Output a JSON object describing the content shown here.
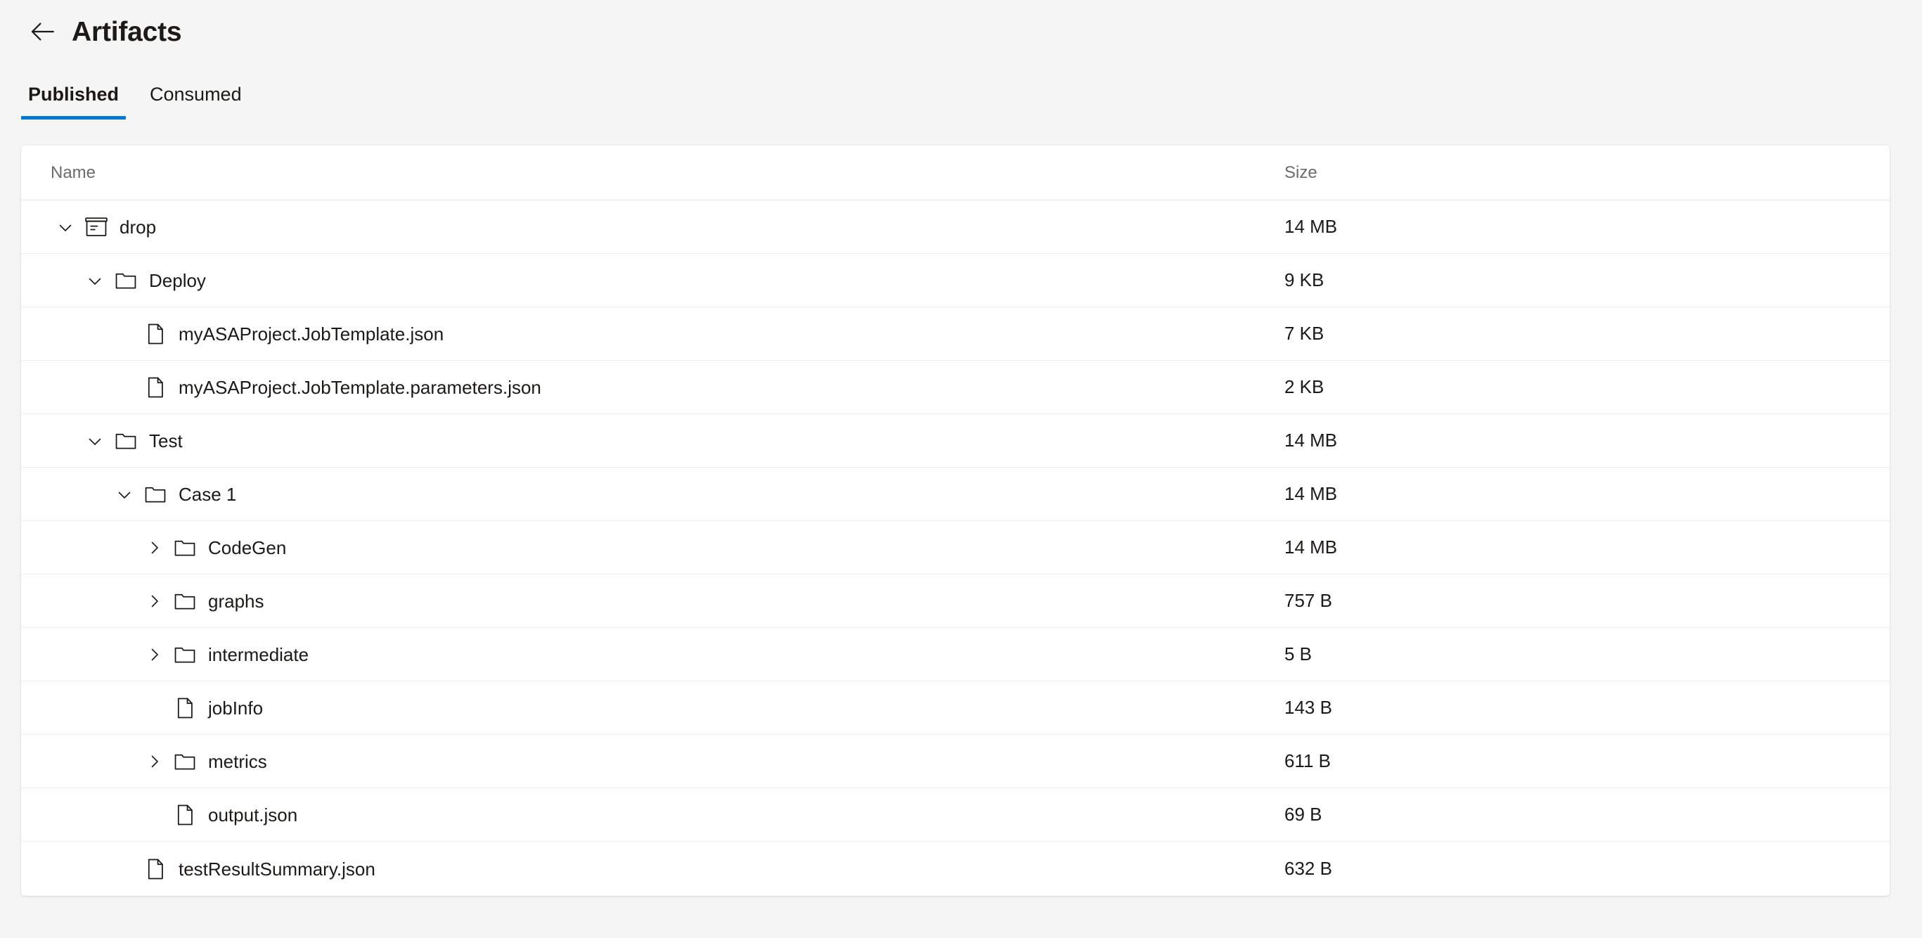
{
  "header": {
    "back_icon": "arrow-left-icon",
    "title": "Artifacts"
  },
  "tabs": [
    {
      "label": "Published",
      "active": true
    },
    {
      "label": "Consumed",
      "active": false
    }
  ],
  "table": {
    "columns": [
      {
        "key": "name",
        "label": "Name"
      },
      {
        "key": "size",
        "label": "Size"
      }
    ],
    "rows": [
      {
        "name": "drop",
        "size": "14 MB",
        "depth": 0,
        "kind": "artifact",
        "icon": "package-icon",
        "expanded": true,
        "has_children": true
      },
      {
        "name": "Deploy",
        "size": "9 KB",
        "depth": 1,
        "kind": "folder",
        "icon": "folder-icon",
        "expanded": true,
        "has_children": true
      },
      {
        "name": "myASAProject.JobTemplate.json",
        "size": "7 KB",
        "depth": 2,
        "kind": "file",
        "icon": "file-icon",
        "expanded": false,
        "has_children": false
      },
      {
        "name": "myASAProject.JobTemplate.parameters.json",
        "size": "2 KB",
        "depth": 2,
        "kind": "file",
        "icon": "file-icon",
        "expanded": false,
        "has_children": false
      },
      {
        "name": "Test",
        "size": "14 MB",
        "depth": 1,
        "kind": "folder",
        "icon": "folder-icon",
        "expanded": true,
        "has_children": true
      },
      {
        "name": "Case 1",
        "size": "14 MB",
        "depth": 2,
        "kind": "folder",
        "icon": "folder-icon",
        "expanded": true,
        "has_children": true
      },
      {
        "name": "CodeGen",
        "size": "14 MB",
        "depth": 3,
        "kind": "folder",
        "icon": "folder-icon",
        "expanded": false,
        "has_children": true
      },
      {
        "name": "graphs",
        "size": "757 B",
        "depth": 3,
        "kind": "folder",
        "icon": "folder-icon",
        "expanded": false,
        "has_children": true
      },
      {
        "name": "intermediate",
        "size": "5 B",
        "depth": 3,
        "kind": "folder",
        "icon": "folder-icon",
        "expanded": false,
        "has_children": true
      },
      {
        "name": "jobInfo",
        "size": "143 B",
        "depth": 3,
        "kind": "file",
        "icon": "file-icon",
        "expanded": false,
        "has_children": false
      },
      {
        "name": "metrics",
        "size": "611 B",
        "depth": 3,
        "kind": "folder",
        "icon": "folder-icon",
        "expanded": false,
        "has_children": true
      },
      {
        "name": "output.json",
        "size": "69 B",
        "depth": 3,
        "kind": "file",
        "icon": "file-icon",
        "expanded": false,
        "has_children": false
      },
      {
        "name": "testResultSummary.json",
        "size": "632 B",
        "depth": 2,
        "kind": "file",
        "icon": "file-icon",
        "expanded": false,
        "has_children": false
      }
    ]
  },
  "colors": {
    "accent": "#0078d4",
    "page_background": "#f5f5f5",
    "card_background": "#ffffff",
    "text": "#1b1a19",
    "muted_text": "#6b6b6b",
    "row_divider": "#ededed"
  }
}
